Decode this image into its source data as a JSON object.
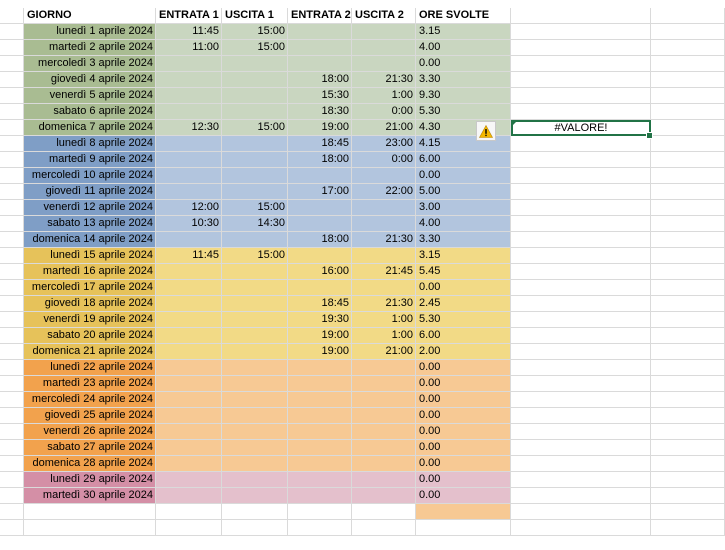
{
  "sheet": {
    "headers": [
      "GIORNO",
      "ENTRATA 1",
      "USCITA 1",
      "ENTRATA 2",
      "USCITA 2",
      "ORE SVOLTE"
    ],
    "rows": [
      {
        "day": "lunedì 1 aprile 2024",
        "e1": "11:45",
        "u1": "15:00",
        "e2": "",
        "u2": "",
        "ore": "3.15"
      },
      {
        "day": "martedì 2 aprile 2024",
        "e1": "11:00",
        "u1": "15:00",
        "e2": "",
        "u2": "",
        "ore": "4.00"
      },
      {
        "day": "mercoledì 3 aprile 2024",
        "e1": "",
        "u1": "",
        "e2": "",
        "u2": "",
        "ore": "0.00"
      },
      {
        "day": "giovedì 4 aprile 2024",
        "e1": "",
        "u1": "",
        "e2": "18:00",
        "u2": "21:30",
        "ore": "3.30"
      },
      {
        "day": "venerdì 5 aprile 2024",
        "e1": "",
        "u1": "",
        "e2": "15:30",
        "u2": "1:00",
        "ore": "9.30"
      },
      {
        "day": "sabato 6 aprile 2024",
        "e1": "",
        "u1": "",
        "e2": "18:30",
        "u2": "0:00",
        "ore": "5.30"
      },
      {
        "day": "domenica 7 aprile 2024",
        "e1": "12:30",
        "u1": "15:00",
        "e2": "19:00",
        "u2": "21:00",
        "ore": "4.30"
      },
      {
        "day": "lunedì 8 aprile 2024",
        "e1": "",
        "u1": "",
        "e2": "18:45",
        "u2": "23:00",
        "ore": "4.15"
      },
      {
        "day": "martedì 9 aprile 2024",
        "e1": "",
        "u1": "",
        "e2": "18:00",
        "u2": "0:00",
        "ore": "6.00"
      },
      {
        "day": "mercoledì 10 aprile 2024",
        "e1": "",
        "u1": "",
        "e2": "",
        "u2": "",
        "ore": "0.00"
      },
      {
        "day": "giovedì 11 aprile 2024",
        "e1": "",
        "u1": "",
        "e2": "17:00",
        "u2": "22:00",
        "ore": "5.00"
      },
      {
        "day": "venerdì 12 aprile 2024",
        "e1": "12:00",
        "u1": "15:00",
        "e2": "",
        "u2": "",
        "ore": "3.00"
      },
      {
        "day": "sabato 13 aprile 2024",
        "e1": "10:30",
        "u1": "14:30",
        "e2": "",
        "u2": "",
        "ore": "4.00"
      },
      {
        "day": "domenica 14 aprile 2024",
        "e1": "",
        "u1": "",
        "e2": "18:00",
        "u2": "21:30",
        "ore": "3.30"
      },
      {
        "day": "lunedì 15 aprile 2024",
        "e1": "11:45",
        "u1": "15:00",
        "e2": "",
        "u2": "",
        "ore": "3.15"
      },
      {
        "day": "martedì 16 aprile 2024",
        "e1": "",
        "u1": "",
        "e2": "16:00",
        "u2": "21:45",
        "ore": "5.45"
      },
      {
        "day": "mercoledì 17 aprile 2024",
        "e1": "",
        "u1": "",
        "e2": "",
        "u2": "",
        "ore": "0.00"
      },
      {
        "day": "giovedì 18 aprile 2024",
        "e1": "",
        "u1": "",
        "e2": "18:45",
        "u2": "21:30",
        "ore": "2.45"
      },
      {
        "day": "venerdì 19 aprile 2024",
        "e1": "",
        "u1": "",
        "e2": "19:30",
        "u2": "1:00",
        "ore": "5.30"
      },
      {
        "day": "sabato 20 aprile 2024",
        "e1": "",
        "u1": "",
        "e2": "19:00",
        "u2": "1:00",
        "ore": "6.00"
      },
      {
        "day": "domenica 21 aprile 2024",
        "e1": "",
        "u1": "",
        "e2": "19:00",
        "u2": "21:00",
        "ore": "2.00"
      },
      {
        "day": "lunedì 22 aprile 2024",
        "e1": "",
        "u1": "",
        "e2": "",
        "u2": "",
        "ore": "0.00"
      },
      {
        "day": "martedì 23 aprile 2024",
        "e1": "",
        "u1": "",
        "e2": "",
        "u2": "",
        "ore": "0.00"
      },
      {
        "day": "mercoledì 24 aprile 2024",
        "e1": "",
        "u1": "",
        "e2": "",
        "u2": "",
        "ore": "0.00"
      },
      {
        "day": "giovedì 25 aprile 2024",
        "e1": "",
        "u1": "",
        "e2": "",
        "u2": "",
        "ore": "0.00"
      },
      {
        "day": "venerdì 26 aprile 2024",
        "e1": "",
        "u1": "",
        "e2": "",
        "u2": "",
        "ore": "0.00"
      },
      {
        "day": "sabato 27 aprile 2024",
        "e1": "",
        "u1": "",
        "e2": "",
        "u2": "",
        "ore": "0.00"
      },
      {
        "day": "domenica 28 aprile 2024",
        "e1": "",
        "u1": "",
        "e2": "",
        "u2": "",
        "ore": "0.00"
      },
      {
        "day": "lunedì 29 aprile 2024",
        "e1": "",
        "u1": "",
        "e2": "",
        "u2": "",
        "ore": "0.00"
      },
      {
        "day": "martedì 30 aprile 2024",
        "e1": "",
        "u1": "",
        "e2": "",
        "u2": "",
        "ore": "0.00"
      }
    ],
    "error_cell": {
      "value": "#VALORE!",
      "row": 6
    },
    "warning_icon": "warning-triangle-icon"
  },
  "colors": {
    "week1": {
      "day": "#a9bc92",
      "body": "#c9d6c0"
    },
    "week2": {
      "day": "#7f9ec6",
      "body": "#b2c5de"
    },
    "week3": {
      "day": "#e6c25a",
      "body": "#f2da86"
    },
    "week4": {
      "day": "#f2a24d",
      "body": "#f7c994"
    },
    "week5": {
      "day": "#d48fa6",
      "body": "#e4c0cc"
    },
    "total": "#f7c994",
    "gridline": "#dadada",
    "selection": "#217346",
    "warning": "#f5b800"
  }
}
